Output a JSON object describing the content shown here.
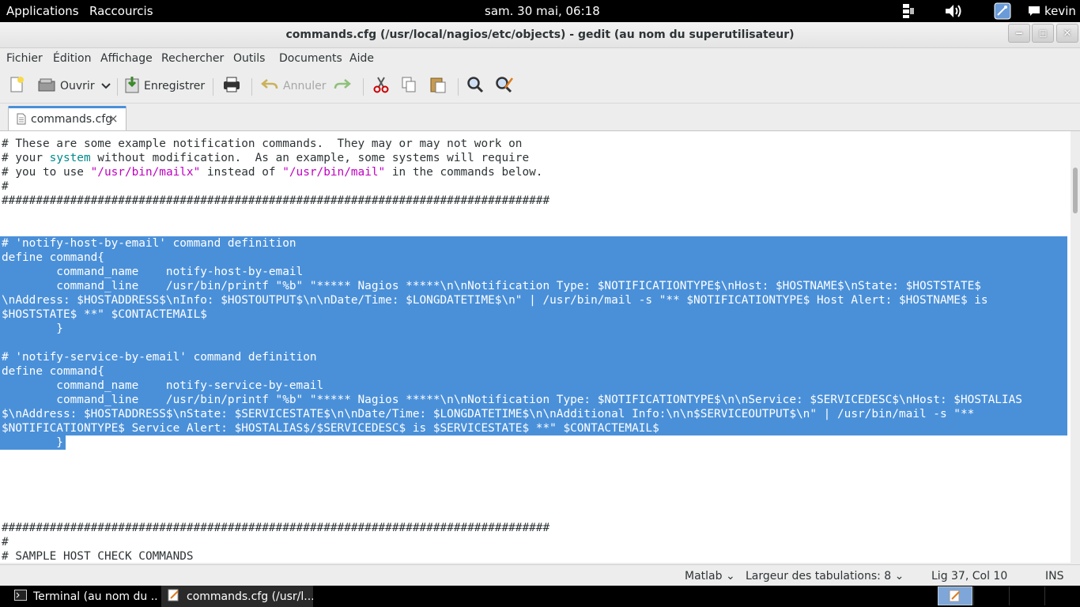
{
  "top_panel": {
    "applications": "Applications",
    "shortcuts": "Raccourcis",
    "clock": "sam. 30 mai, 06:18",
    "user": "kevin",
    "icons": [
      "network-icon",
      "volume-icon",
      "accessibility-icon",
      "chat-icon"
    ]
  },
  "window": {
    "title": "commands.cfg (/usr/local/nagios/etc/objects) - gedit (au nom du superutilisateur)",
    "controls": [
      "minimize",
      "maximize",
      "close"
    ]
  },
  "menu": [
    "Fichier",
    "Édition",
    "Affichage",
    "Rechercher",
    "Outils",
    "Documents",
    "Aide"
  ],
  "toolbar": {
    "open_label": "Ouvrir",
    "save_label": "Enregistrer",
    "undo_label": "Annuler"
  },
  "tab": {
    "label": "commands.cfg",
    "close": "×"
  },
  "editor": {
    "lines": [
      "# These are some example notification commands.  They may or may not work on",
      "# your system without modification.  As an example, some systems will require",
      "# you to use \"/usr/bin/mailx\" instead of \"/usr/bin/mail\" in the commands below.",
      "#",
      "################################################################################",
      "",
      "",
      "# 'notify-host-by-email' command definition",
      "define command{",
      "        command_name    notify-host-by-email",
      "        command_line    /usr/bin/printf \"%b\" \"***** Nagios *****\\n\\nNotification Type: $NOTIFICATIONTYPE$\\nHost: $HOSTNAME$\\nState: $HOSTSTATE$",
      "\\nAddress: $HOSTADDRESS$\\nInfo: $HOSTOUTPUT$\\n\\nDate/Time: $LONGDATETIME$\\n\" | /usr/bin/mail -s \"** $NOTIFICATIONTYPE$ Host Alert: $HOSTNAME$ is",
      "$HOSTSTATE$ **\" $CONTACTEMAIL$",
      "        }",
      "",
      "# 'notify-service-by-email' command definition",
      "define command{",
      "        command_name    notify-service-by-email",
      "        command_line    /usr/bin/printf \"%b\" \"***** Nagios *****\\n\\nNotification Type: $NOTIFICATIONTYPE$\\n\\nService: $SERVICEDESC$\\nHost: $HOSTALIAS",
      "$\\nAddress: $HOSTADDRESS$\\nState: $SERVICESTATE$\\n\\nDate/Time: $LONGDATETIME$\\n\\nAdditional Info:\\n\\n$SERVICEOUTPUT$\\n\" | /usr/bin/mail -s \"**",
      "$NOTIFICATIONTYPE$ Service Alert: $HOSTALIAS$/$SERVICEDESC$ is $SERVICESTATE$ **\" $CONTACTEMAIL$",
      "        }",
      "",
      "",
      "",
      "",
      "################################################################################",
      "#",
      "# SAMPLE HOST CHECK COMMANDS"
    ],
    "line1_parts": [
      "# your ",
      "system",
      " without modification.  As an example, some systems will require"
    ],
    "line2_parts": [
      "# you to use ",
      "\"/usr/bin/mailx\"",
      " instead of ",
      "\"/usr/bin/mail\"",
      " in the commands below."
    ]
  },
  "status": {
    "language": "Matlab",
    "tab_width_label": "Largeur des tabulations:",
    "tab_width": "8",
    "position": "Lig 37, Col 10",
    "mode": "INS"
  },
  "taskbar": {
    "tasks": [
      "Terminal (au nom du ...",
      "commands.cfg (/usr/l..."
    ]
  },
  "colors": {
    "selection": "#4a90d9",
    "string": "#c000c0",
    "keyword": "#008a8c"
  }
}
